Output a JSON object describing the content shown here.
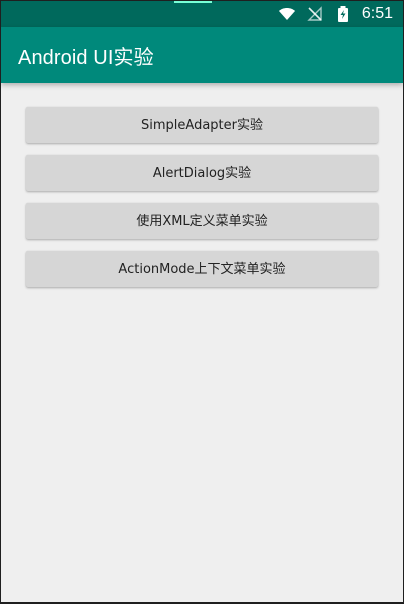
{
  "status_bar": {
    "time": "6:51",
    "icons": [
      "wifi-icon",
      "signal-off-icon",
      "battery-charging-icon"
    ],
    "bg_color": "#00695c"
  },
  "toolbar": {
    "title": "Android UI实验",
    "bg_color": "#00897b"
  },
  "buttons": [
    {
      "label": "SimpleAdapter实验"
    },
    {
      "label": "AlertDialog实验"
    },
    {
      "label": "使用XML定义菜单实验"
    },
    {
      "label": "ActionMode上下文菜单实验"
    }
  ]
}
